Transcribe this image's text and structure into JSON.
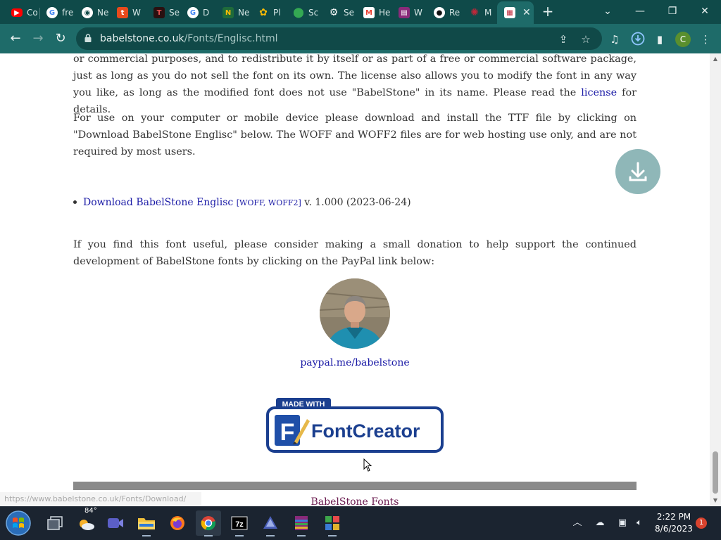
{
  "browser": {
    "tabs": [
      {
        "title": "Co",
        "icon": "youtube-icon",
        "color": "#ff0000"
      },
      {
        "title": "fre",
        "icon": "google-icon",
        "color": "#ffffff"
      },
      {
        "title": "Ne",
        "icon": "chrome-icon",
        "color": "#ffffff"
      },
      {
        "title": "W",
        "icon": "t-app-icon",
        "color": "#e84a1c"
      },
      {
        "title": "Se",
        "icon": "dark-app-icon",
        "color": "#7a1a1a"
      },
      {
        "title": "D",
        "icon": "google-icon",
        "color": "#ffffff"
      },
      {
        "title": "Ne",
        "icon": "news-icon",
        "color": "#1f6b3a"
      },
      {
        "title": "Pl",
        "icon": "pinwheel-icon",
        "color": "#34a853"
      },
      {
        "title": "Sc",
        "icon": "maps-icon",
        "color": "#4285f4"
      },
      {
        "title": "Se",
        "icon": "settings-icon",
        "color": "#ffffff"
      },
      {
        "title": "He",
        "icon": "gmail-icon",
        "color": "#ea4335"
      },
      {
        "title": "W",
        "icon": "winrar-icon",
        "color": "#8a2a7a"
      },
      {
        "title": "Re",
        "icon": "github-icon",
        "color": "#ffffff"
      },
      {
        "title": "M",
        "icon": "virus-icon",
        "color": "#c0283a"
      },
      {
        "title": "",
        "icon": "babelstone-icon",
        "color": "#c0283a",
        "active": true
      }
    ],
    "new_tab_label": "+",
    "window_controls": {
      "dropdown": "⌄",
      "minimize": "—",
      "restore": "❐",
      "close": "✕"
    },
    "url_host": "babelstone.co.uk",
    "url_path": "/Fonts/Englisc.html",
    "profile_initial": "C",
    "nav": {
      "back": "←",
      "forward": "→",
      "reload": "↻"
    }
  },
  "page": {
    "para1_pre": "or commercial purposes, and to redistribute it by itself or as part of a free or commercial software package, just as long as you do not sell the font on its own. The license also allows you to modify the font in any way you like, as long as the modified font does not use \"BabelStone\" in its name. Please read the ",
    "para1_link": "license",
    "para1_post": " for details.",
    "para2": "For use on your computer or mobile device please download and install the TTF file by clicking on \"Download BabelStone Englisc\" below. The WOFF and WOFF2 files are for web hosting use only, and are not required by most users.",
    "download_link": "Download BabelStone Englisc",
    "download_open": "[",
    "woff": "WOFF",
    "woff_sep": ", ",
    "woff2": "WOFF2",
    "download_close": "]",
    "download_version": " v. 1.000 (2023-06-24)",
    "para3": "If you find this font useful, please consider making a small donation to help support the continued development of BabelStone fonts by clicking on the PayPal link below:",
    "paypal_link": "paypal.me/babelstone",
    "badge_top": "MADE WITH",
    "badge_main": "FontCreator",
    "footer_link": "BabelStone Fonts",
    "status_tip": "https://www.babelstone.co.uk/Fonts/Download/"
  },
  "taskbar": {
    "weather_temp": "84°",
    "time": "2:22 PM",
    "date": "8/6/2023",
    "notification_count": "1",
    "apps": [
      {
        "name": "task-view-icon"
      },
      {
        "name": "weather-icon"
      },
      {
        "name": "meet-icon"
      },
      {
        "name": "file-explorer-icon"
      },
      {
        "name": "firefox-icon"
      },
      {
        "name": "chrome-icon"
      },
      {
        "name": "7zip-icon"
      },
      {
        "name": "inkscape-icon"
      },
      {
        "name": "winrar-icon"
      },
      {
        "name": "app-grid-icon"
      }
    ]
  },
  "colors": {
    "tabstrip": "#0f4a49",
    "toolbar": "#1e6b69",
    "link": "#1a1aa6",
    "visited_link": "#6b1b4f",
    "fab": "#8fb7b8"
  }
}
